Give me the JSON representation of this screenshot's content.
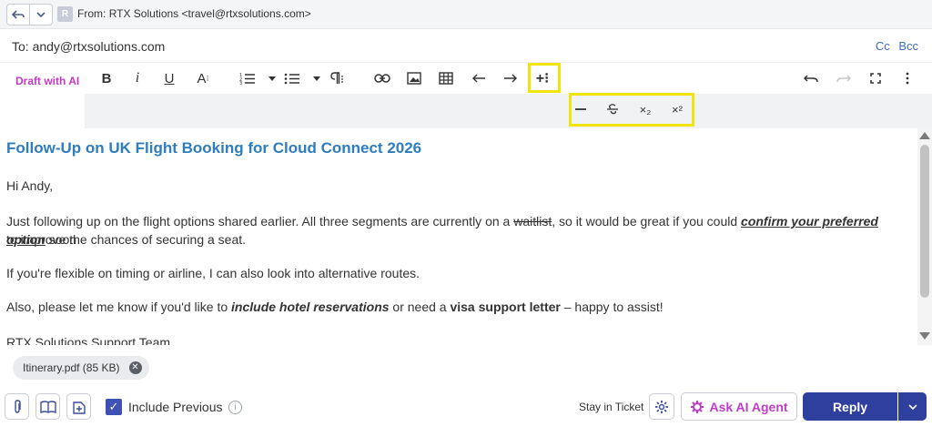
{
  "header": {
    "from_label": "From:",
    "from_value": "RTX Solutions <travel@rtxsolutions.com>",
    "avatar_letter": "R",
    "to_label": "To:",
    "to_value": "andy@rtxsolutions.com",
    "cc_label": "Cc",
    "bcc_label": "Bcc"
  },
  "toolbar": {
    "draft_ai_label": "Draft with AI",
    "bold_label": "B",
    "italic_label": "i",
    "underline_label": "U",
    "font_size_label": "A",
    "insert_more_label": "+⁝",
    "hr_label": "—",
    "subscript_label": "×₂",
    "superscript_label": "×²",
    "highlight_color": "#f1e40a"
  },
  "email": {
    "subject": "Follow-Up on UK Flight Booking for Cloud Connect 2026",
    "greeting": "Hi Andy,",
    "p1_a": "Just following up on the flight options shared earlier. All three segments are currently on a ",
    "p1_strike": "waitlist",
    "p1_b": ", so it would be great if you could ",
    "p1_emph": "confirm your preferred option",
    "p1_c": " soon",
    "p1_line2": "to improve the chances of securing a seat.",
    "p2": "If you're flexible on timing or airline, I can also look into alternative routes.",
    "p3_a": "Also, please let me know if you'd like to ",
    "p3_emph": "include hotel reservations",
    "p3_b": " or need a ",
    "p3_bold": "visa support letter",
    "p3_c": " – happy to assist!",
    "signature": "RTX Solutions Support Team"
  },
  "attachment": {
    "name": "Itinerary.pdf (85 KB)"
  },
  "footer": {
    "include_previous_label": "Include Previous",
    "include_previous_checked": true,
    "stay_in_ticket_label": "Stay in Ticket",
    "ask_ai_label": "Ask AI Agent",
    "reply_label": "Reply"
  },
  "colors": {
    "accent": "#2f3f9e",
    "subject": "#2d7dbf",
    "ai_pink": "#c13ac8"
  }
}
